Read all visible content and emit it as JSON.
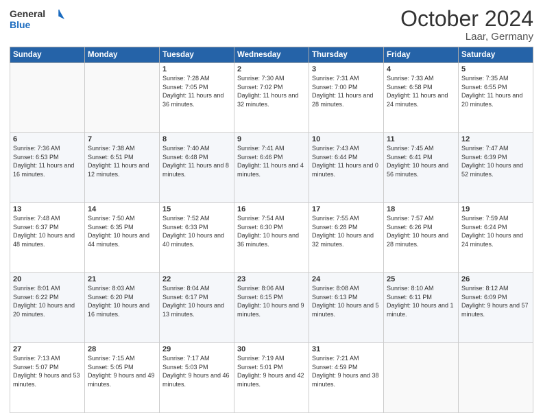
{
  "header": {
    "logo_general": "General",
    "logo_blue": "Blue",
    "title": "October 2024",
    "location": "Laar, Germany"
  },
  "weekdays": [
    "Sunday",
    "Monday",
    "Tuesday",
    "Wednesday",
    "Thursday",
    "Friday",
    "Saturday"
  ],
  "weeks": [
    [
      {
        "day": "",
        "sunrise": "",
        "sunset": "",
        "daylight": ""
      },
      {
        "day": "",
        "sunrise": "",
        "sunset": "",
        "daylight": ""
      },
      {
        "day": "1",
        "sunrise": "Sunrise: 7:28 AM",
        "sunset": "Sunset: 7:05 PM",
        "daylight": "Daylight: 11 hours and 36 minutes."
      },
      {
        "day": "2",
        "sunrise": "Sunrise: 7:30 AM",
        "sunset": "Sunset: 7:02 PM",
        "daylight": "Daylight: 11 hours and 32 minutes."
      },
      {
        "day": "3",
        "sunrise": "Sunrise: 7:31 AM",
        "sunset": "Sunset: 7:00 PM",
        "daylight": "Daylight: 11 hours and 28 minutes."
      },
      {
        "day": "4",
        "sunrise": "Sunrise: 7:33 AM",
        "sunset": "Sunset: 6:58 PM",
        "daylight": "Daylight: 11 hours and 24 minutes."
      },
      {
        "day": "5",
        "sunrise": "Sunrise: 7:35 AM",
        "sunset": "Sunset: 6:55 PM",
        "daylight": "Daylight: 11 hours and 20 minutes."
      }
    ],
    [
      {
        "day": "6",
        "sunrise": "Sunrise: 7:36 AM",
        "sunset": "Sunset: 6:53 PM",
        "daylight": "Daylight: 11 hours and 16 minutes."
      },
      {
        "day": "7",
        "sunrise": "Sunrise: 7:38 AM",
        "sunset": "Sunset: 6:51 PM",
        "daylight": "Daylight: 11 hours and 12 minutes."
      },
      {
        "day": "8",
        "sunrise": "Sunrise: 7:40 AM",
        "sunset": "Sunset: 6:48 PM",
        "daylight": "Daylight: 11 hours and 8 minutes."
      },
      {
        "day": "9",
        "sunrise": "Sunrise: 7:41 AM",
        "sunset": "Sunset: 6:46 PM",
        "daylight": "Daylight: 11 hours and 4 minutes."
      },
      {
        "day": "10",
        "sunrise": "Sunrise: 7:43 AM",
        "sunset": "Sunset: 6:44 PM",
        "daylight": "Daylight: 11 hours and 0 minutes."
      },
      {
        "day": "11",
        "sunrise": "Sunrise: 7:45 AM",
        "sunset": "Sunset: 6:41 PM",
        "daylight": "Daylight: 10 hours and 56 minutes."
      },
      {
        "day": "12",
        "sunrise": "Sunrise: 7:47 AM",
        "sunset": "Sunset: 6:39 PM",
        "daylight": "Daylight: 10 hours and 52 minutes."
      }
    ],
    [
      {
        "day": "13",
        "sunrise": "Sunrise: 7:48 AM",
        "sunset": "Sunset: 6:37 PM",
        "daylight": "Daylight: 10 hours and 48 minutes."
      },
      {
        "day": "14",
        "sunrise": "Sunrise: 7:50 AM",
        "sunset": "Sunset: 6:35 PM",
        "daylight": "Daylight: 10 hours and 44 minutes."
      },
      {
        "day": "15",
        "sunrise": "Sunrise: 7:52 AM",
        "sunset": "Sunset: 6:33 PM",
        "daylight": "Daylight: 10 hours and 40 minutes."
      },
      {
        "day": "16",
        "sunrise": "Sunrise: 7:54 AM",
        "sunset": "Sunset: 6:30 PM",
        "daylight": "Daylight: 10 hours and 36 minutes."
      },
      {
        "day": "17",
        "sunrise": "Sunrise: 7:55 AM",
        "sunset": "Sunset: 6:28 PM",
        "daylight": "Daylight: 10 hours and 32 minutes."
      },
      {
        "day": "18",
        "sunrise": "Sunrise: 7:57 AM",
        "sunset": "Sunset: 6:26 PM",
        "daylight": "Daylight: 10 hours and 28 minutes."
      },
      {
        "day": "19",
        "sunrise": "Sunrise: 7:59 AM",
        "sunset": "Sunset: 6:24 PM",
        "daylight": "Daylight: 10 hours and 24 minutes."
      }
    ],
    [
      {
        "day": "20",
        "sunrise": "Sunrise: 8:01 AM",
        "sunset": "Sunset: 6:22 PM",
        "daylight": "Daylight: 10 hours and 20 minutes."
      },
      {
        "day": "21",
        "sunrise": "Sunrise: 8:03 AM",
        "sunset": "Sunset: 6:20 PM",
        "daylight": "Daylight: 10 hours and 16 minutes."
      },
      {
        "day": "22",
        "sunrise": "Sunrise: 8:04 AM",
        "sunset": "Sunset: 6:17 PM",
        "daylight": "Daylight: 10 hours and 13 minutes."
      },
      {
        "day": "23",
        "sunrise": "Sunrise: 8:06 AM",
        "sunset": "Sunset: 6:15 PM",
        "daylight": "Daylight: 10 hours and 9 minutes."
      },
      {
        "day": "24",
        "sunrise": "Sunrise: 8:08 AM",
        "sunset": "Sunset: 6:13 PM",
        "daylight": "Daylight: 10 hours and 5 minutes."
      },
      {
        "day": "25",
        "sunrise": "Sunrise: 8:10 AM",
        "sunset": "Sunset: 6:11 PM",
        "daylight": "Daylight: 10 hours and 1 minute."
      },
      {
        "day": "26",
        "sunrise": "Sunrise: 8:12 AM",
        "sunset": "Sunset: 6:09 PM",
        "daylight": "Daylight: 9 hours and 57 minutes."
      }
    ],
    [
      {
        "day": "27",
        "sunrise": "Sunrise: 7:13 AM",
        "sunset": "Sunset: 5:07 PM",
        "daylight": "Daylight: 9 hours and 53 minutes."
      },
      {
        "day": "28",
        "sunrise": "Sunrise: 7:15 AM",
        "sunset": "Sunset: 5:05 PM",
        "daylight": "Daylight: 9 hours and 49 minutes."
      },
      {
        "day": "29",
        "sunrise": "Sunrise: 7:17 AM",
        "sunset": "Sunset: 5:03 PM",
        "daylight": "Daylight: 9 hours and 46 minutes."
      },
      {
        "day": "30",
        "sunrise": "Sunrise: 7:19 AM",
        "sunset": "Sunset: 5:01 PM",
        "daylight": "Daylight: 9 hours and 42 minutes."
      },
      {
        "day": "31",
        "sunrise": "Sunrise: 7:21 AM",
        "sunset": "Sunset: 4:59 PM",
        "daylight": "Daylight: 9 hours and 38 minutes."
      },
      {
        "day": "",
        "sunrise": "",
        "sunset": "",
        "daylight": ""
      },
      {
        "day": "",
        "sunrise": "",
        "sunset": "",
        "daylight": ""
      }
    ]
  ]
}
